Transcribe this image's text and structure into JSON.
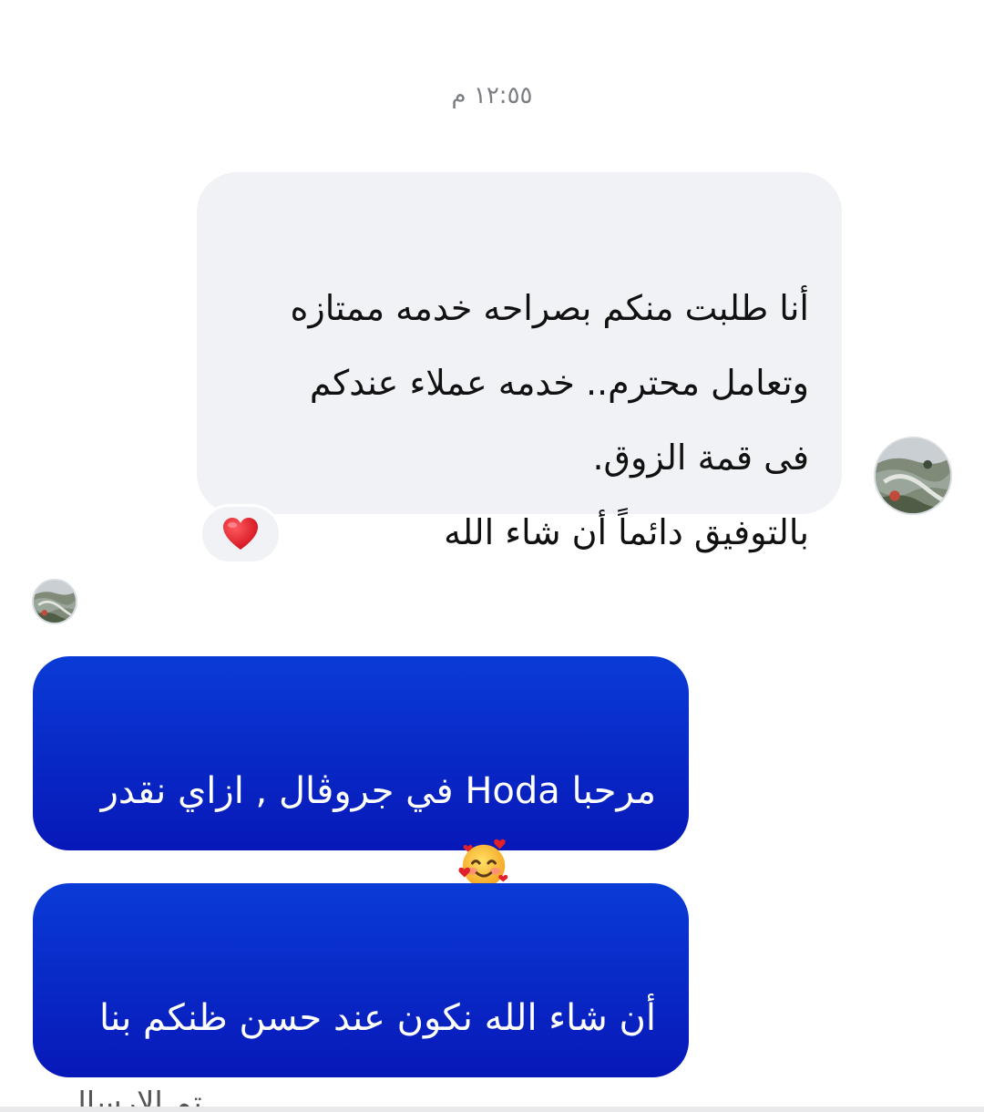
{
  "chat": {
    "timestamp": "١٢:٥٥ م",
    "incoming": {
      "text": "أنا طلبت منكم بصراحه خدمه ممتازه\nوتعامل محترم.. خدمه عملاء عندكم\nفى قمة الزوق.\nبالتوفيق دائماً أن شاء الله",
      "reaction": "heart-icon"
    },
    "outgoing": [
      {
        "text": "مرحبا Hoda في جروڤال , ازاي نقدر\nنساعدك؟",
        "emoji": "smiling-face-with-hearts-icon"
      },
      {
        "text": "أن شاء الله نكون عند حسن ظنكم بنا\nدايما يافندم"
      }
    ],
    "partial_bottom_text": "تم الإرسال"
  },
  "colors": {
    "incoming_bubble": "#f1f2f6",
    "outgoing_bubble_top": "#0a3bd6",
    "outgoing_bubble_bottom": "#0718b8",
    "reaction_heart": "#e0202b"
  }
}
